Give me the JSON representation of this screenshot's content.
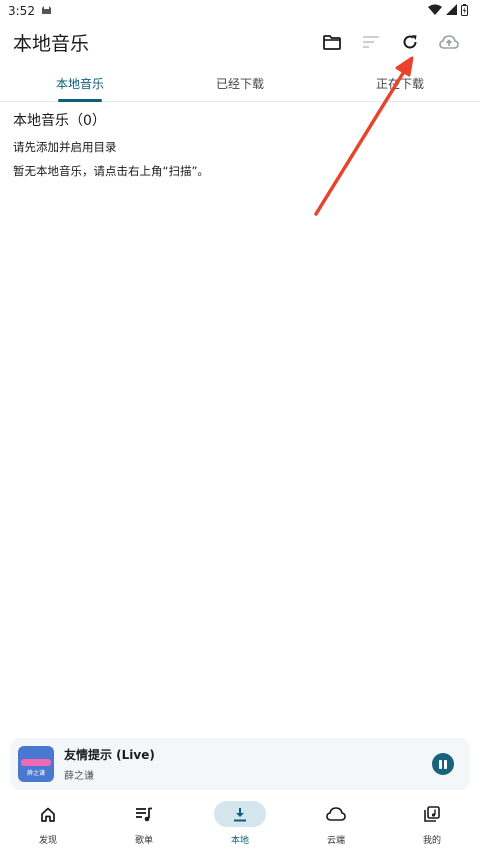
{
  "status": {
    "time": "3:52"
  },
  "app": {
    "title": "本地音乐"
  },
  "tabs": [
    {
      "label": "本地音乐",
      "active": true
    },
    {
      "label": "已经下载",
      "active": false
    },
    {
      "label": "正在下载",
      "active": false
    }
  ],
  "content": {
    "section_title": "本地音乐（0）",
    "hint_add_dir": "请先添加并启用目录",
    "hint_empty": "暂无本地音乐，请点击右上角“扫描”。"
  },
  "player": {
    "title": "友情提示 (Live)",
    "artist": "薛之谦",
    "cover_text": "薛之谦",
    "state": "playing"
  },
  "nav": [
    {
      "label": "发现",
      "icon": "home-icon",
      "active": false
    },
    {
      "label": "歌单",
      "icon": "playlist-icon",
      "active": false
    },
    {
      "label": "本地",
      "icon": "download-icon",
      "active": true
    },
    {
      "label": "云端",
      "icon": "cloud-icon",
      "active": false
    },
    {
      "label": "我的",
      "icon": "library-icon",
      "active": false
    }
  ],
  "colors": {
    "accent": "#0c5f79",
    "arrow": "#e8432d",
    "nav_active_bg": "#d5e5ee"
  }
}
